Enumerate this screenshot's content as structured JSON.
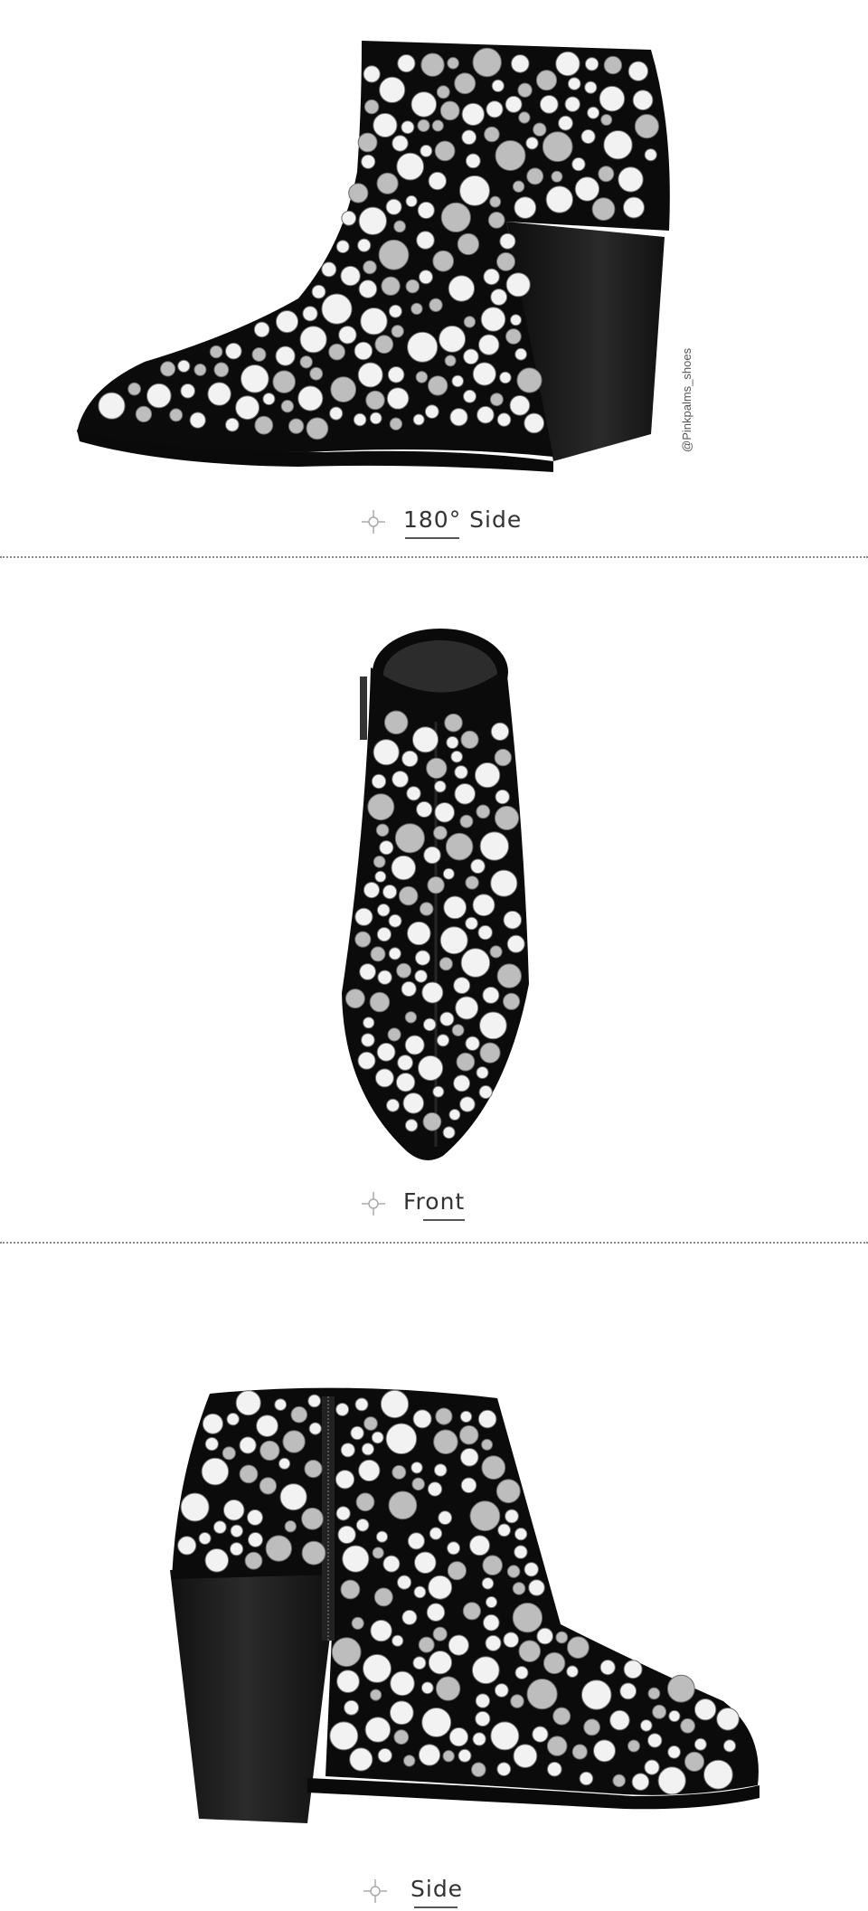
{
  "sections": [
    {
      "caption": "180° Side"
    },
    {
      "caption": "Front"
    },
    {
      "caption": "Side"
    }
  ],
  "watermark": "@Pinkpalms_shoes",
  "colors": {
    "suede": "#0c0c0c",
    "stud": "#d9d9d9",
    "heel": "#1a1a1a",
    "divider": "#8a8a8a"
  }
}
